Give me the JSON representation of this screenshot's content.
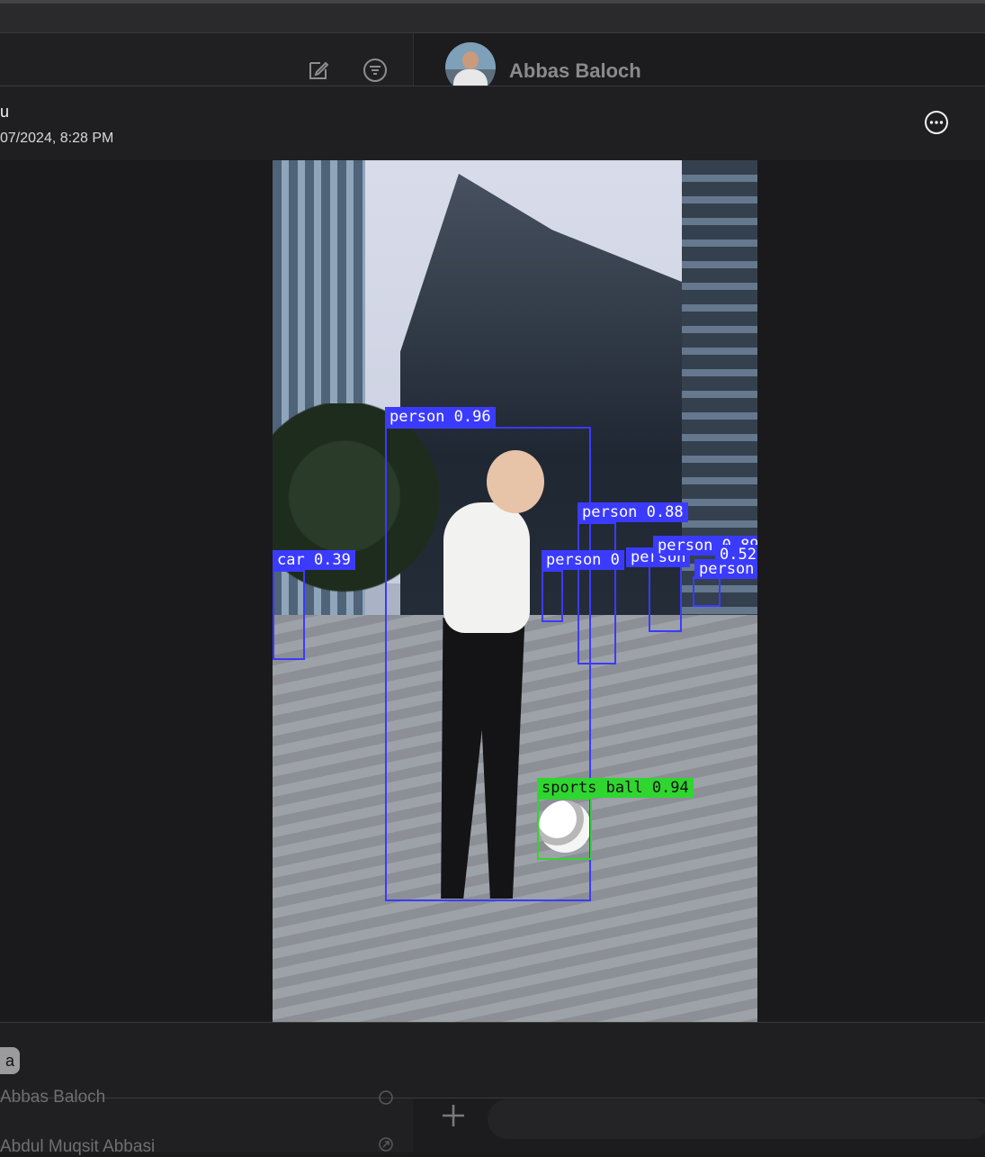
{
  "chat_header": {
    "name": "Abbas Baloch"
  },
  "left_toolbar": {
    "compose_icon": "compose-icon",
    "filter_icon": "filter-icon"
  },
  "viewer_header": {
    "sender": "u",
    "datetime": "07/2024, 8:28 PM",
    "more_icon": "ellipsis-circle-icon"
  },
  "detections": [
    {
      "label": "person 0.96"
    },
    {
      "label": "person 0.88"
    },
    {
      "label": "car 0.39"
    },
    {
      "label": "person 0"
    },
    {
      "label": "person"
    },
    {
      "label": "person 0.89"
    },
    {
      "label": "person"
    },
    {
      "label": "sports ball 0.94"
    },
    {
      "label": "0.52"
    }
  ],
  "bottom": {
    "chip": "a",
    "chat_list_items": [
      "Abbas Baloch",
      "Abdul Muqsit Abbasi"
    ],
    "plus_icon": "plus-icon"
  },
  "colors": {
    "detection_box": "#3b3bff",
    "sports_ball_box": "#2fd62f"
  }
}
